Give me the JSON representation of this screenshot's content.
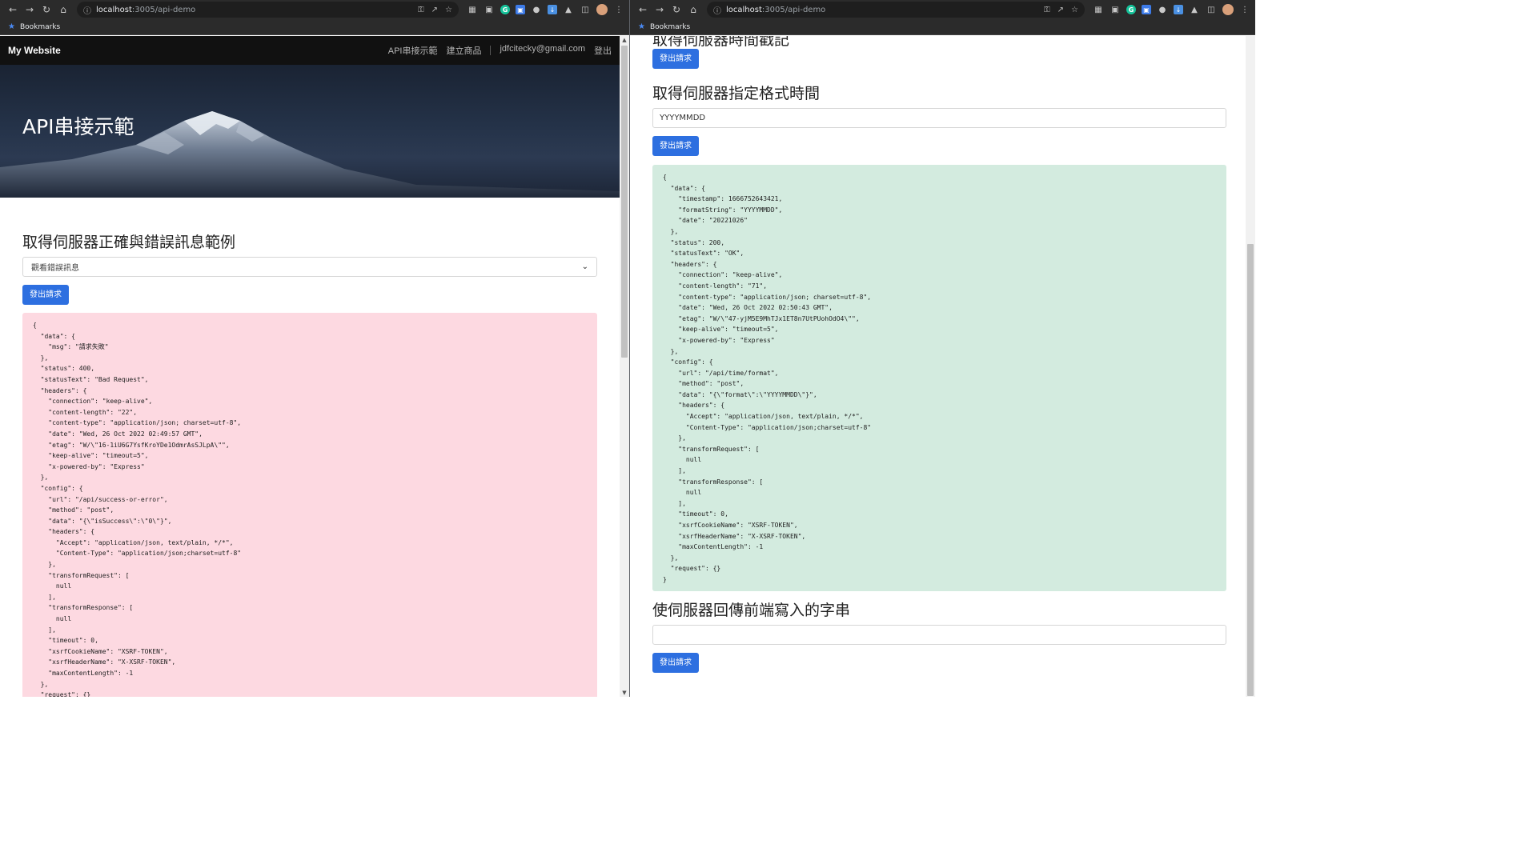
{
  "browser": {
    "url_host": "localhost",
    "url_rest": ":3005/api-demo",
    "bookmarks_label": "Bookmarks"
  },
  "site": {
    "brand": "My Website",
    "nav": [
      "API串接示範",
      "建立商品",
      "jdfcitecky@gmail.com",
      "登出"
    ],
    "hero_title": "API串接示範"
  },
  "left": {
    "section_title": "取得伺服器正確與錯誤訊息範例",
    "select_value": "觀看錯誤訊息",
    "button_label": "發出請求",
    "response_json": "{\n  \"data\": {\n    \"msg\": \"請求失敗\"\n  },\n  \"status\": 400,\n  \"statusText\": \"Bad Request\",\n  \"headers\": {\n    \"connection\": \"keep-alive\",\n    \"content-length\": \"22\",\n    \"content-type\": \"application/json; charset=utf-8\",\n    \"date\": \"Wed, 26 Oct 2022 02:49:57 GMT\",\n    \"etag\": \"W/\\\"16-1iU6G7YsfKroYDe1OdmrAsSJLpA\\\"\",\n    \"keep-alive\": \"timeout=5\",\n    \"x-powered-by\": \"Express\"\n  },\n  \"config\": {\n    \"url\": \"/api/success-or-error\",\n    \"method\": \"post\",\n    \"data\": \"{\\\"isSuccess\\\":\\\"0\\\"}\",\n    \"headers\": {\n      \"Accept\": \"application/json, text/plain, */*\",\n      \"Content-Type\": \"application/json;charset=utf-8\"\n    },\n    \"transformRequest\": [\n      null\n    ],\n    \"transformResponse\": [\n      null\n    ],\n    \"timeout\": 0,\n    \"xsrfCookieName\": \"XSRF-TOKEN\",\n    \"xsrfHeaderName\": \"X-XSRF-TOKEN\",\n    \"maxContentLength\": -1\n  },\n  \"request\": {}\n}"
  },
  "right": {
    "partial_title": "取得伺服器時間戳記",
    "button_label": "發出請求",
    "format_section_title": "取得伺服器指定格式時間",
    "format_input_value": "YYYYMMDD",
    "format_response_json": "{\n  \"data\": {\n    \"timestamp\": 1666752643421,\n    \"formatString\": \"YYYYMMDD\",\n    \"date\": \"20221026\"\n  },\n  \"status\": 200,\n  \"statusText\": \"OK\",\n  \"headers\": {\n    \"connection\": \"keep-alive\",\n    \"content-length\": \"71\",\n    \"content-type\": \"application/json; charset=utf-8\",\n    \"date\": \"Wed, 26 Oct 2022 02:50:43 GMT\",\n    \"etag\": \"W/\\\"47-yjM5E9MhTJx1ET8n7UtPUohOdO4\\\"\",\n    \"keep-alive\": \"timeout=5\",\n    \"x-powered-by\": \"Express\"\n  },\n  \"config\": {\n    \"url\": \"/api/time/format\",\n    \"method\": \"post\",\n    \"data\": \"{\\\"format\\\":\\\"YYYYMMDD\\\"}\",\n    \"headers\": {\n      \"Accept\": \"application/json, text/plain, */*\",\n      \"Content-Type\": \"application/json;charset=utf-8\"\n    },\n    \"transformRequest\": [\n      null\n    ],\n    \"transformResponse\": [\n      null\n    ],\n    \"timeout\": 0,\n    \"xsrfCookieName\": \"XSRF-TOKEN\",\n    \"xsrfHeaderName\": \"X-XSRF-TOKEN\",\n    \"maxContentLength\": -1\n  },\n  \"request\": {}\n}",
    "echo_section_title": "使伺服器回傳前端寫入的字串",
    "echo_input_value": ""
  },
  "colors": {
    "button": "#2d6fe0",
    "error_bg": "#fdd9e1",
    "success_bg": "#d3ebdf",
    "navbar_bg": "#111111"
  }
}
